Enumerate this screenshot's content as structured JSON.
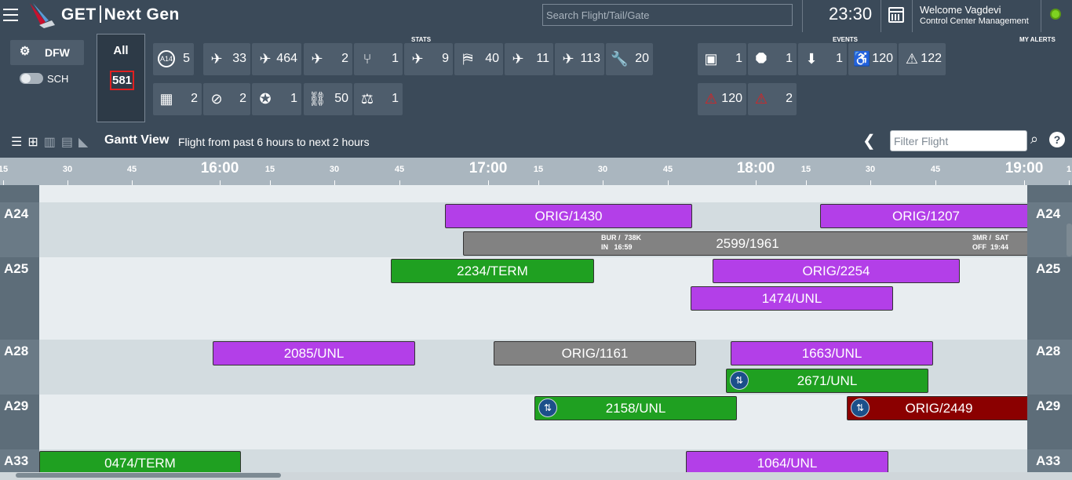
{
  "header": {
    "app_prefix": "GET",
    "app_name": "Next Gen",
    "search_placeholder": "Search Flight/Tail/Gate",
    "time": "23:30",
    "welcome": "Welcome Vagdevi",
    "role": "Control Center Management"
  },
  "station": {
    "code": "DFW",
    "toggle_label": "SCH"
  },
  "all": {
    "label": "All",
    "count": "581"
  },
  "section_titles": {
    "stats": "STATS",
    "events": "EVENTS",
    "alerts": "MY ALERTS"
  },
  "stats": [
    {
      "icon": "a14-icon",
      "glyph": "A14",
      "value": "5"
    },
    {
      "icon": "taxi-icon",
      "glyph": "✈",
      "value": "33"
    },
    {
      "icon": "delayed-departure-icon",
      "glyph": "✈",
      "value": "464"
    },
    {
      "icon": "delayed-arrival-icon",
      "glyph": "✈",
      "value": "2"
    },
    {
      "icon": "diversion-icon",
      "glyph": "⑂",
      "value": "1"
    },
    {
      "icon": "on-time-icon",
      "glyph": "✈",
      "value": "9"
    },
    {
      "icon": "gate-icon",
      "glyph": "⛿",
      "value": "40"
    },
    {
      "icon": "aircraft-icon",
      "glyph": "✈",
      "value": "11"
    },
    {
      "icon": "late-icon",
      "glyph": "✈",
      "value": "113"
    },
    {
      "icon": "wrench-icon",
      "glyph": "🔧",
      "value": "20"
    },
    {
      "icon": "scan-icon",
      "glyph": "▦",
      "value": "2"
    },
    {
      "icon": "no-fly-icon",
      "glyph": "⊘",
      "value": "2"
    },
    {
      "icon": "badge-icon",
      "glyph": "✪",
      "value": "1"
    },
    {
      "icon": "broken-link-icon",
      "glyph": "⛓",
      "value": "50"
    },
    {
      "icon": "weight-icon",
      "glyph": "⚖",
      "value": "1"
    }
  ],
  "events": [
    {
      "icon": "baggage-icon",
      "glyph": "▣",
      "value": "1"
    },
    {
      "icon": "stop-icon",
      "glyph": "⯃",
      "value": "1"
    },
    {
      "icon": "inbox-icon",
      "glyph": "⬇",
      "value": "1"
    },
    {
      "icon": "passenger-icon",
      "glyph": "♿",
      "value": "120"
    },
    {
      "icon": "warning-icon",
      "glyph": "⚠",
      "value": "122"
    },
    {
      "icon": "warning-red-icon",
      "glyph": "⚠",
      "value": "120"
    },
    {
      "icon": "alert-red-icon",
      "glyph": "⚠",
      "value": "2"
    }
  ],
  "gantt": {
    "view_label": "Gantt View",
    "info": "Flight from past 6 hours to next 2 hours",
    "filter_placeholder": "Filter Flight",
    "help": "?"
  },
  "timeline": {
    "ticks": [
      "15",
      "30",
      "45",
      "16:00",
      "15",
      "30",
      "45",
      "17:00",
      "15",
      "30",
      "45",
      "18:00",
      "15",
      "30",
      "45",
      "19:00",
      "1"
    ]
  },
  "lanes": [
    {
      "gate": "A24",
      "bars": [
        {
          "label": "ORIG/1430",
          "color": "purple"
        },
        {
          "label": "ORIG/1207",
          "color": "purple"
        },
        {
          "label": "2599/1961",
          "color": "gray",
          "in_info": "BUR /  738K",
          "in_time": "IN   16:59",
          "out_info": "3MR /  SAT",
          "out_time": "OFF  19:44"
        }
      ]
    },
    {
      "gate": "A25",
      "bars": [
        {
          "label": "2234/TERM",
          "color": "green"
        },
        {
          "label": "ORIG/2254",
          "color": "purple"
        },
        {
          "label": "1474/UNL",
          "color": "purple"
        }
      ]
    },
    {
      "gate": "A28",
      "bars": [
        {
          "label": "2085/UNL",
          "color": "purple"
        },
        {
          "label": "ORIG/1161",
          "color": "gray"
        },
        {
          "label": "1663/UNL",
          "color": "purple"
        },
        {
          "label": "2671/UNL",
          "color": "green"
        }
      ]
    },
    {
      "gate": "A29",
      "bars": [
        {
          "label": "2158/UNL",
          "color": "green"
        },
        {
          "label": "ORIG/2449",
          "color": "red"
        }
      ]
    },
    {
      "gate": "A33",
      "bars": [
        {
          "label": "0474/TERM",
          "color": "green"
        },
        {
          "label": "1064/UNL",
          "color": "purple"
        }
      ]
    }
  ]
}
